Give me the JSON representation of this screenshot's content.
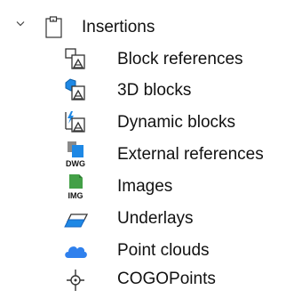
{
  "tree": {
    "parent": {
      "label": "Insertions",
      "expanded": true,
      "icon": "folder-icon"
    },
    "children": [
      {
        "label": "Block references",
        "icon": "block-reference-icon"
      },
      {
        "label": "3D blocks",
        "icon": "3d-block-icon"
      },
      {
        "label": "Dynamic blocks",
        "icon": "dynamic-block-icon"
      },
      {
        "label": "External references",
        "icon": "dwg-xref-icon",
        "icon_text": "DWG"
      },
      {
        "label": "Images",
        "icon": "image-icon",
        "icon_text": "IMG"
      },
      {
        "label": "Underlays",
        "icon": "underlay-icon"
      },
      {
        "label": "Point clouds",
        "icon": "point-cloud-icon"
      },
      {
        "label": "COGOPoints",
        "icon": "cogo-point-icon"
      }
    ]
  },
  "colors": {
    "accent_blue": "#1e88e5",
    "cloud_blue": "#2f80ed",
    "image_green": "#43a047",
    "dwg_gray": "#8a8a8a"
  }
}
